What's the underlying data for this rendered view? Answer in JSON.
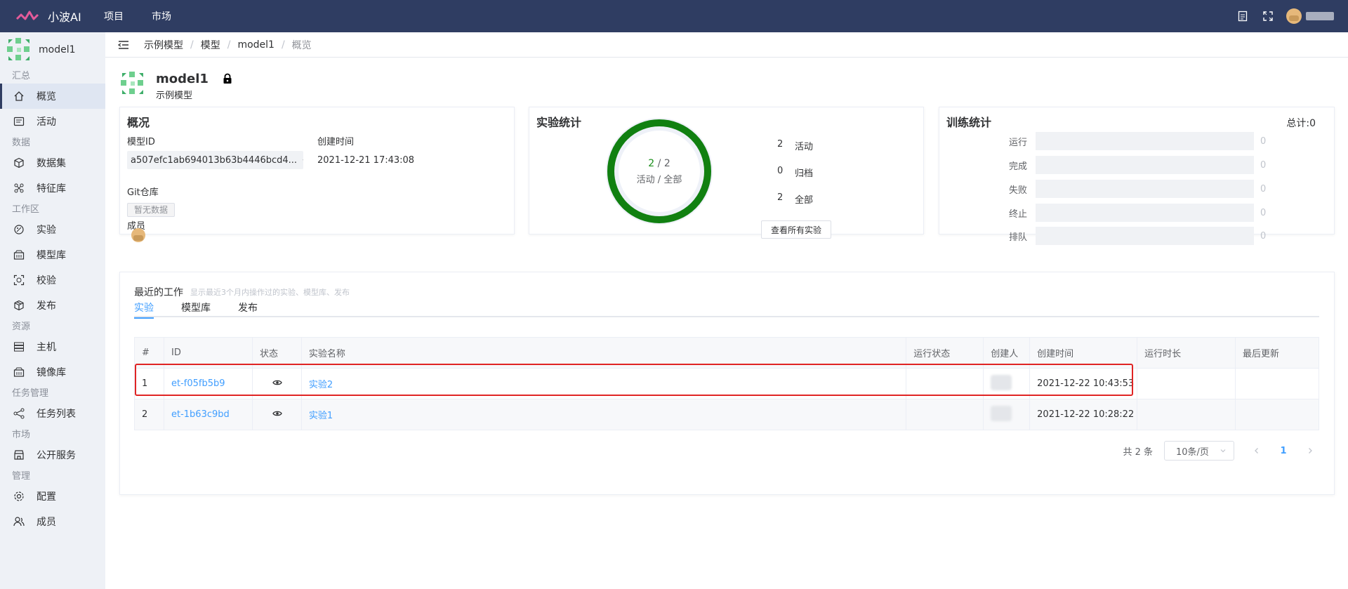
{
  "topbar": {
    "app_name": "小波AI",
    "nav": [
      "项目",
      "市场"
    ],
    "icons": [
      "document-icon",
      "fullscreen-icon"
    ]
  },
  "sidebar": {
    "project_name": "model1",
    "groups": [
      {
        "title": "汇总",
        "items": [
          {
            "label": "概览",
            "icon": "home-icon",
            "active": true
          },
          {
            "label": "活动",
            "icon": "activity-icon"
          }
        ]
      },
      {
        "title": "数据",
        "items": [
          {
            "label": "数据集",
            "icon": "cube-icon"
          },
          {
            "label": "特征库",
            "icon": "feature-icon"
          }
        ]
      },
      {
        "title": "工作区",
        "items": [
          {
            "label": "实验",
            "icon": "flask-icon"
          },
          {
            "label": "模型库",
            "icon": "model-store-icon"
          },
          {
            "label": "校验",
            "icon": "inspect-icon"
          },
          {
            "label": "发布",
            "icon": "package-icon"
          }
        ]
      },
      {
        "title": "资源",
        "items": [
          {
            "label": "主机",
            "icon": "server-icon"
          },
          {
            "label": "镜像库",
            "icon": "image-store-icon"
          }
        ]
      },
      {
        "title": "任务管理",
        "items": [
          {
            "label": "任务列表",
            "icon": "share-icon"
          }
        ]
      },
      {
        "title": "市场",
        "items": [
          {
            "label": "公开服务",
            "icon": "shop-icon"
          }
        ]
      },
      {
        "title": "管理",
        "items": [
          {
            "label": "配置",
            "icon": "gear-icon"
          },
          {
            "label": "成员",
            "icon": "users-icon"
          }
        ]
      }
    ]
  },
  "breadcrumb": [
    "示例模型",
    "模型",
    "model1",
    "概览"
  ],
  "header": {
    "name": "model1",
    "subtitle": "示例模型"
  },
  "overview": {
    "title": "概况",
    "model_id_label": "模型ID",
    "model_id": "a507efc1ab694013b63b4446bcd4...",
    "created_label": "创建时间",
    "created": "2021-12-21 17:43:08",
    "git_label": "Git仓库",
    "git_empty": "暂无数据",
    "members_label": "成员"
  },
  "experiment_stats": {
    "title": "实验统计",
    "active": "2",
    "total": "2",
    "sep": "/",
    "center_label": "活动 / 全部",
    "rows": [
      {
        "num": "2",
        "label": "活动"
      },
      {
        "num": "0",
        "label": "归档"
      },
      {
        "num": "2",
        "label": "全部"
      }
    ],
    "view_all": "查看所有实验",
    "ring_color": "#118011"
  },
  "training_stats": {
    "title": "训练统计",
    "total": "总计:0",
    "rows": [
      {
        "label": "运行",
        "value": "0"
      },
      {
        "label": "完成",
        "value": "0"
      },
      {
        "label": "失败",
        "value": "0"
      },
      {
        "label": "终止",
        "value": "0"
      },
      {
        "label": "排队",
        "value": "0"
      }
    ]
  },
  "recent": {
    "title": "最近的工作",
    "hint": "显示最近3个月内操作过的实验、模型库、发布",
    "tabs": [
      "实验",
      "模型库",
      "发布"
    ],
    "columns": [
      "#",
      "ID",
      "状态",
      "实验名称",
      "运行状态",
      "创建人",
      "创建时间",
      "运行时长",
      "最后更新"
    ],
    "rows": [
      {
        "idx": "1",
        "id": "et-f05fb5b9",
        "name": "实验2",
        "run_status": "",
        "created": "2021-12-22 10:43:53",
        "duration": "",
        "updated": ""
      },
      {
        "idx": "2",
        "id": "et-1b63c9bd",
        "name": "实验1",
        "run_status": "",
        "created": "2021-12-22 10:28:22",
        "duration": "",
        "updated": ""
      }
    ],
    "pager": {
      "total": "共 2 条",
      "page_size": "10条/页",
      "current": "1"
    }
  },
  "colors": {
    "topbar": "#2f3d62",
    "link": "#409eff",
    "highlight": "#e02424"
  }
}
